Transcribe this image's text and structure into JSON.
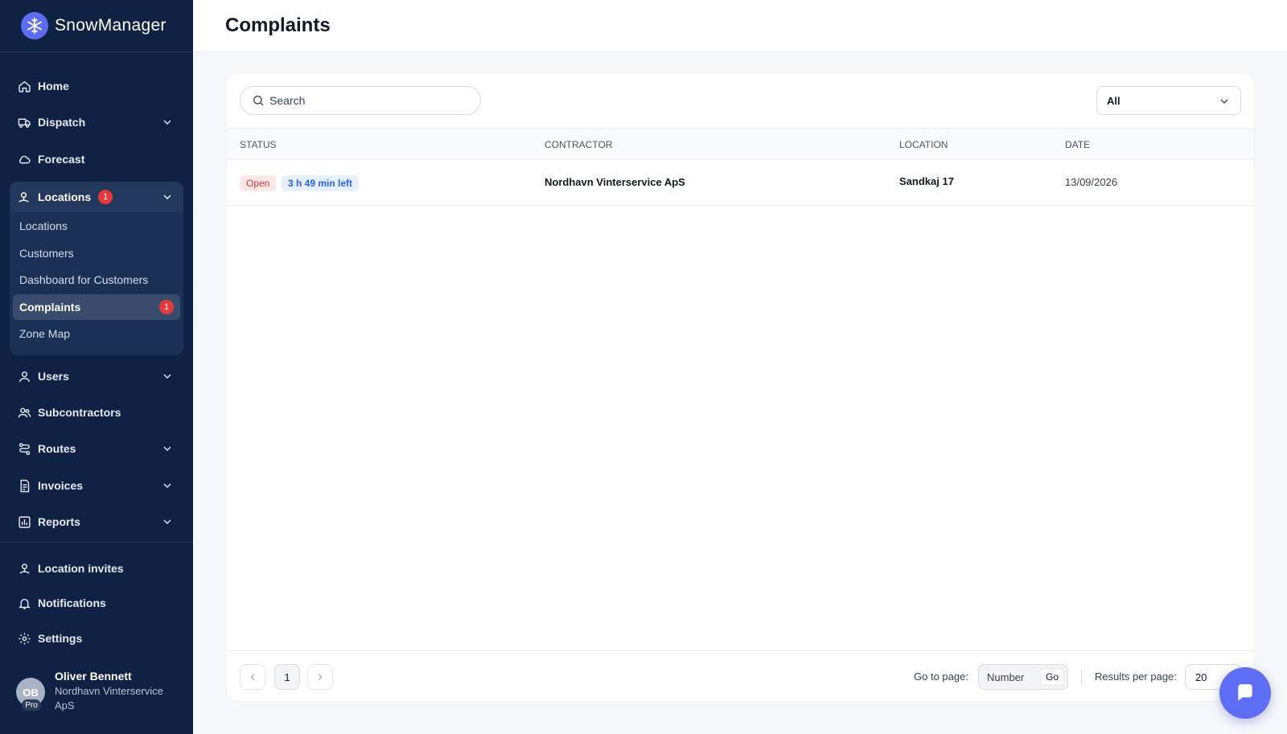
{
  "app": {
    "name": "SnowManager"
  },
  "page": {
    "title": "Complaints"
  },
  "sidebar": {
    "items": [
      {
        "label": "Home",
        "icon": "home-icon"
      },
      {
        "label": "Dispatch",
        "icon": "truck-icon"
      },
      {
        "label": "Forecast",
        "icon": "cloud-icon"
      },
      {
        "label": "Locations",
        "icon": "location-pin-icon",
        "badge": "1"
      },
      {
        "label": "Users",
        "icon": "user-icon"
      },
      {
        "label": "Subcontractors",
        "icon": "users-icon"
      },
      {
        "label": "Routes",
        "icon": "route-icon"
      },
      {
        "label": "Invoices",
        "icon": "invoice-icon"
      },
      {
        "label": "Reports",
        "icon": "bar-chart-icon"
      },
      {
        "label": "Location invites",
        "icon": "location-pin-icon"
      },
      {
        "label": "Notifications",
        "icon": "bell-icon"
      },
      {
        "label": "Settings",
        "icon": "gear-icon"
      }
    ],
    "locations_submenu": [
      {
        "label": "Locations"
      },
      {
        "label": "Customers"
      },
      {
        "label": "Dashboard for Customers"
      },
      {
        "label": "Complaints",
        "badge": "1",
        "active": true
      },
      {
        "label": "Zone Map"
      }
    ],
    "user": {
      "initials": "OB",
      "plan": "Pro",
      "name": "Oliver Bennett",
      "org": "Nordhavn Vinterservice ApS"
    }
  },
  "search": {
    "placeholder": "Search",
    "value": ""
  },
  "filter": {
    "selected": "All"
  },
  "table": {
    "headers": [
      "STATUS",
      "CONTRACTOR",
      "LOCATION",
      "DATE"
    ],
    "rows": [
      {
        "status": "Open",
        "time_left": "3 h 49 min left",
        "contractor": "Nordhavn Vinterservice ApS",
        "location": "Sandkaj 17",
        "date": "13/09/2026"
      }
    ]
  },
  "pagination": {
    "current_page": "1",
    "goto_label": "Go to page:",
    "goto_placeholder": "Number",
    "goto_button": "Go",
    "results_label": "Results per page:",
    "results_value": "20"
  },
  "colors": {
    "sidebar_bg": "#0f2244",
    "accent": "#5d6ef5",
    "badge": "#e5393a",
    "open_status": "#d93636",
    "time_badge": "#2563eb"
  }
}
